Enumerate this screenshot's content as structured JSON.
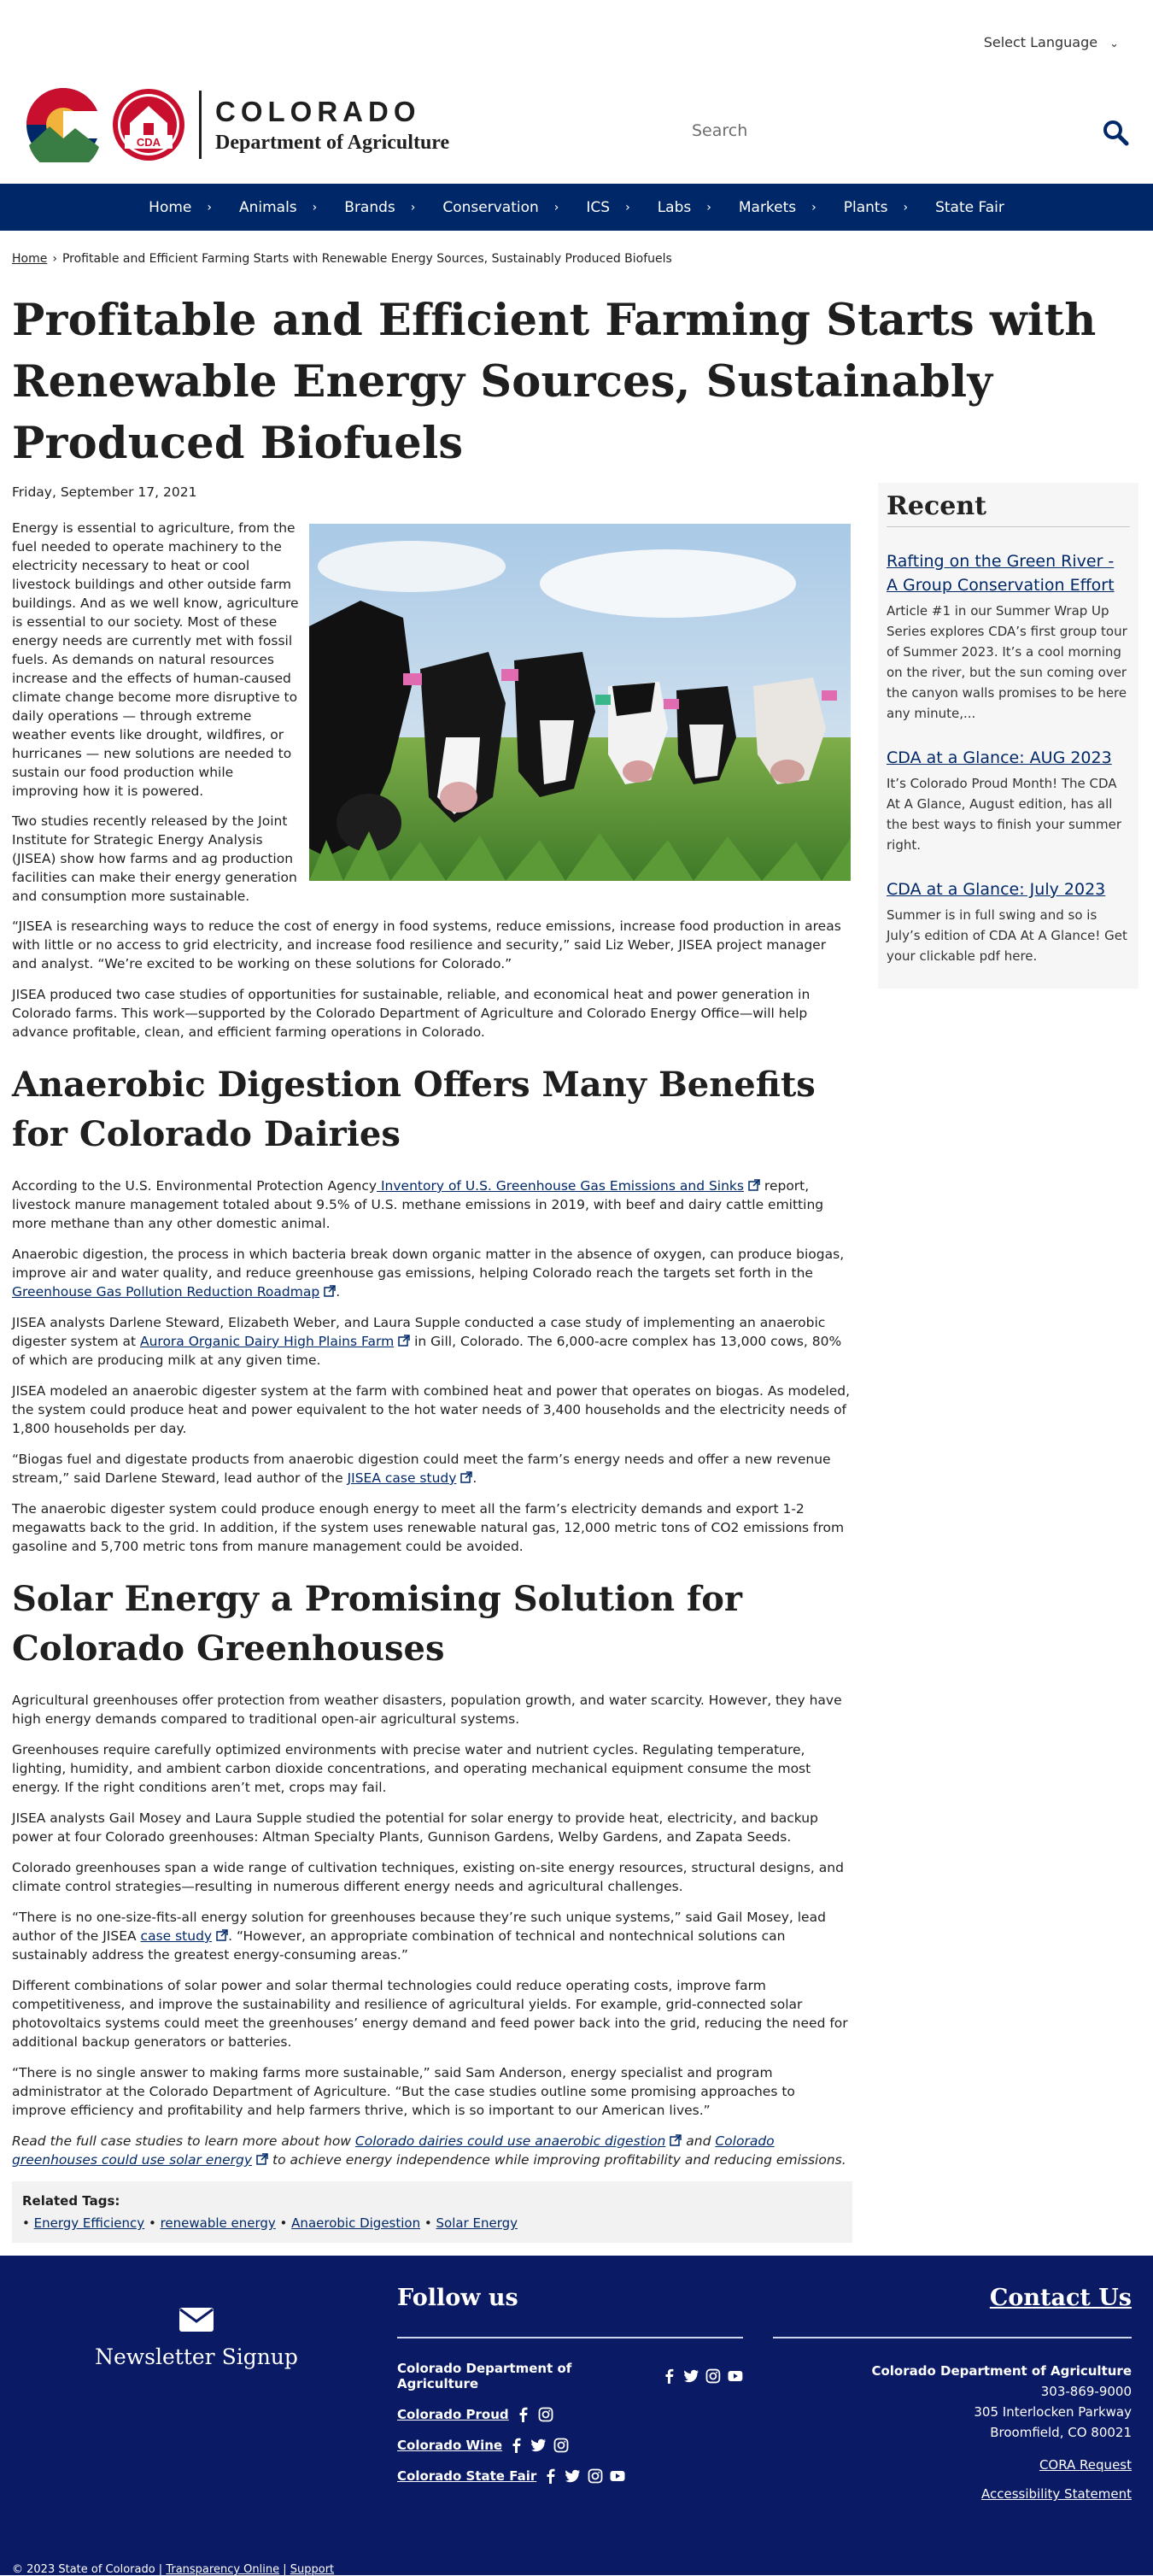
{
  "header": {
    "language_label": "Select Language",
    "brand_state": "COLORADO",
    "brand_dept": "Department of Agriculture",
    "cda_badge": "CDA",
    "search_placeholder": "Search"
  },
  "nav": {
    "items": [
      "Home",
      "Animals",
      "Brands",
      "Conservation",
      "ICS",
      "Labs",
      "Markets",
      "Plants",
      "State Fair"
    ]
  },
  "breadcrumb": {
    "home": "Home",
    "current": "Profitable and Efficient Farming Starts with Renewable Energy Sources, Sustainably Produced Biofuels"
  },
  "article": {
    "title": "Profitable and Efficient Farming Starts with Renewable Energy Sources, Sustainably Produced Biofuels",
    "date": "Friday, September 17, 2021",
    "intro_p1": "Energy is essential to agriculture, from the fuel needed to operate machinery to the electricity necessary to heat or cool livestock buildings and other outside farm buildings. And as we well know, agriculture is essential to our society. Most of these energy needs are currently met with fossil fuels. As demands on natural resources increase and the effects of human-caused climate change become more disruptive to daily operations — through extreme weather events like drought, wildfires, or hurricanes — new solutions are needed to sustain our food production while improving how it is powered.",
    "intro_p2": "Two studies recently released by the Joint Institute for Strategic Energy Analysis (JISEA) show how farms and ag production facilities can make their energy generation and consumption more sustainable.",
    "p3": "“JISEA is researching ways to reduce the cost of energy in food systems, reduce emissions, increase food production in areas with little or no access to grid electricity, and increase food resilience and security,” said Liz Weber, JISEA project manager and analyst. “We’re excited to be working on these solutions for Colorado.”",
    "p4": "JISEA produced two case studies of opportunities for sustainable, reliable, and economical heat and power generation in Colorado farms. This work—supported by the Colorado Department of Agriculture and Colorado Energy Office—will help advance profitable, clean, and efficient farming operations in Colorado.",
    "h2_dairies": "Anaerobic Digestion Offers Many Benefits for Colorado Dairies",
    "d1_pre": "According to the U.S. Environmental Protection Agency",
    "d1_link": " Inventory of U.S. Greenhouse Gas Emissions and Sinks",
    "d1_post": " report, livestock manure management totaled about 9.5% of U.S. methane emissions in 2019, with beef and dairy cattle emitting more methane than any other domestic animal.",
    "d2_pre": "Anaerobic digestion, the process in which bacteria break down organic matter in the absence of oxygen, can produce biogas, improve air and water quality, and reduce greenhouse gas emissions, helping Colorado reach the targets set forth in the ",
    "d2_link": "Greenhouse Gas Pollution Reduction Roadmap",
    "d2_post": ".",
    "d3_pre": "JISEA analysts Darlene Steward, Elizabeth Weber, and Laura Supple conducted a case study of implementing an anaerobic digester system at ",
    "d3_link": "Aurora Organic Dairy High Plains Farm",
    "d3_post": " in Gill, Colorado. The 6,000-acre complex has 13,000 cows, 80% of which are producing milk at any given time.",
    "d4": "JISEA modeled an anaerobic digester system at the farm with combined heat and power that operates on biogas. As modeled, the system could produce heat and power equivalent to the hot water needs of 3,400 households and the electricity needs of 1,800 households per day.",
    "d5_pre": "“Biogas fuel and digestate products from anaerobic digestion could meet the farm’s energy needs and offer a new revenue stream,” said Darlene Steward, lead author of the ",
    "d5_link": "JISEA case study",
    "d5_post": ".",
    "d6": "The anaerobic digester system could produce enough energy to meet all the farm’s electricity demands and export 1-2 megawatts back to the grid. In addition, if the system uses renewable natural gas, 12,000 metric tons of CO2 emissions from gasoline and 5,700 metric tons from manure management could be avoided.",
    "h2_solar": "Solar Energy a Promising Solution for Colorado Greenhouses",
    "s1": "Agricultural greenhouses offer protection from weather disasters, population growth, and water scarcity. However, they have high energy demands compared to traditional open-air agricultural systems.",
    "s2": "Greenhouses require carefully optimized environments with precise water and nutrient cycles. Regulating temperature, lighting, humidity, and ambient carbon dioxide concentrations, and operating mechanical equipment consume the most energy. If the right conditions aren’t met, crops may fail.",
    "s3": "JISEA analysts Gail Mosey and Laura Supple studied the potential for solar energy to provide heat, electricity, and backup power at four Colorado greenhouses: Altman Specialty Plants, Gunnison Gardens, Welby Gardens, and Zapata Seeds.",
    "s4": "Colorado greenhouses span a wide range of cultivation techniques, existing on-site energy resources, structural designs, and climate control strategies—resulting in numerous different energy needs and agricultural challenges.",
    "s5_pre": "“There is no one-size-fits-all energy solution for greenhouses because they’re such unique systems,” said Gail Mosey, lead author of the JISEA ",
    "s5_link": "case study",
    "s5_post": ". “However, an appropriate combination of technical and nontechnical solutions can sustainably address the greatest energy-consuming areas.”",
    "s6": "Different combinations of solar power and solar thermal technologies could reduce operating costs, improve farm competitiveness, and improve the sustainability and resilience of agricultural yields. For example, grid-connected solar photovoltaics systems could meet the greenhouses’ energy demand and feed power back into the grid, reducing the need for additional backup generators or batteries.",
    "s7": "“There is no single answer to making farms more sustainable,” said Sam Anderson, energy specialist and program administrator at the Colorado Department of Agriculture. “But the case studies outline some promising approaches to improve efficiency and profitability and help farmers thrive, which is so important to our American lives.”",
    "s8_pre": "Read the full case studies to learn more about how ",
    "s8_link1": "Colorado dairies could use anaerobic digestion",
    "s8_mid": " and ",
    "s8_link2": "Colorado greenhouses could use solar energy",
    "s8_post": " to achieve energy independence while improving profitability and reducing emissions.",
    "related_label": "Related Tags:",
    "tags": [
      "Energy Efficiency",
      "renewable energy",
      "Anaerobic Digestion",
      "Solar Energy"
    ]
  },
  "sidebar": {
    "heading": "Recent",
    "items": [
      {
        "title": "Rafting on the Green River - A Group Conservation Effort",
        "summary": "Article #1 in our Summer Wrap Up Series explores CDA’s first group tour of Summer 2023.   It’s a cool morning on the river, but the sun coming over the canyon walls promises to be here any minute,..."
      },
      {
        "title": "CDA at a Glance: AUG 2023",
        "summary": "It’s Colorado Proud Month! The CDA At A Glance, August edition, has all the best ways to finish your summer right."
      },
      {
        "title": "CDA at a Glance: July 2023",
        "summary": "Summer is in full swing and so is July’s edition of CDA At A Glance! Get your clickable pdf here."
      }
    ]
  },
  "footer": {
    "newsletter": "Newsletter Signup",
    "follow_heading": "Follow us",
    "social": [
      {
        "label": "Colorado Department of Agriculture",
        "link": false
      },
      {
        "label": "Colorado Proud",
        "link": true
      },
      {
        "label": "Colorado Wine",
        "link": true
      },
      {
        "label": "Colorado State Fair",
        "link": true
      }
    ],
    "contact_heading": "Contact Us",
    "contact_name": "Colorado Department of Agriculture",
    "phone": "303-869-9000",
    "address1": "305 Interlocken Parkway",
    "address2": "Broomfield, CO 80021",
    "cora": "CORA Request",
    "accessibility": "Accessibility Statement",
    "copyright": "© 2023 State of Colorado",
    "transparency": "Transparency Online",
    "support": "Support"
  },
  "colors": {
    "nav_bg": "#002868",
    "footer_bg": "#0a1a64",
    "link": "#002868",
    "accent_red": "#c8102e",
    "accent_gold": "#f2b33d"
  }
}
